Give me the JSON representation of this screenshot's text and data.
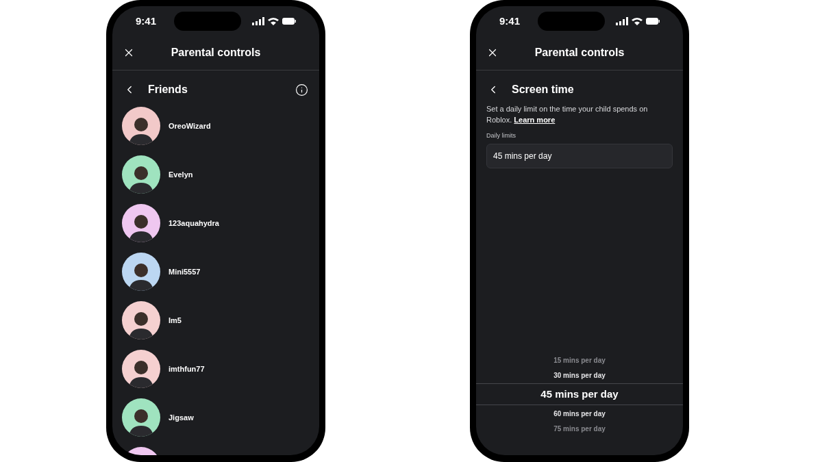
{
  "phones": [
    {
      "status_bar": {
        "time": "9:41"
      },
      "header": {
        "title": "Parental controls"
      },
      "subheader": {
        "title": "Friends",
        "actions": [
          {
            "kind": "info"
          }
        ]
      },
      "friends": [
        {
          "name": "OreoWizard",
          "color": "#f2c9c9"
        },
        {
          "name": "Evelyn",
          "color": "#9fe3bf"
        },
        {
          "name": "123aquahydra",
          "color": "#efc7f0"
        },
        {
          "name": "Mini5557",
          "color": "#bcd7f2"
        },
        {
          "name": "Im5",
          "color": "#f5d0d0"
        },
        {
          "name": "imthfun77",
          "color": "#f5d0d0"
        },
        {
          "name": "Jigsaw",
          "color": "#9fe3bf"
        },
        {
          "color": "#efc7f0"
        }
      ]
    },
    {
      "status_bar": {
        "time": "9:41"
      },
      "header": {
        "title": "Parental controls"
      },
      "subheader": {
        "title": "Screen time"
      },
      "description": "Set a daily limit on the time your child spends on Roblox.",
      "link": "Learn more",
      "field": {
        "label": "Daily limits",
        "value": "45 mins per day"
      },
      "picker": [
        {
          "label": "15 mins per day",
          "selected": false
        },
        {
          "label": "30 mins per day",
          "selected": false
        },
        {
          "label": "45 mins per day",
          "selected": true
        },
        {
          "label": "60 mins per day",
          "selected": false
        },
        {
          "label": "75 mins per day",
          "selected": false
        }
      ]
    }
  ]
}
